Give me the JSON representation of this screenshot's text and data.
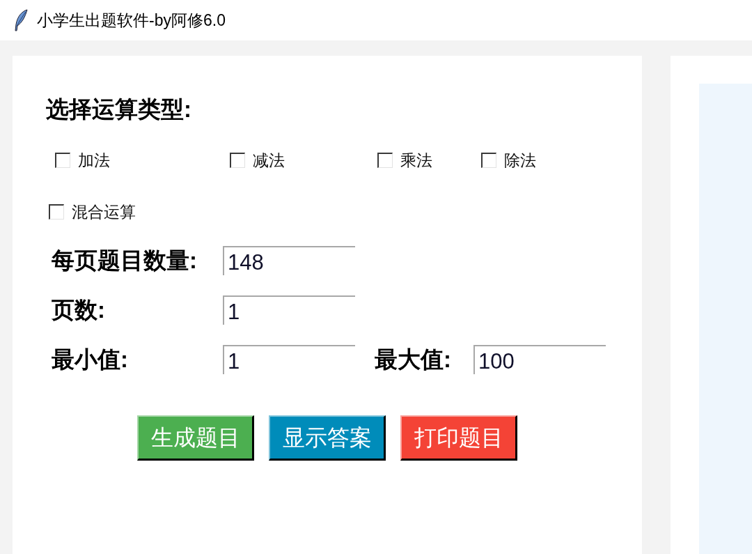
{
  "window": {
    "title": "小学生出题软件-by阿修6.0"
  },
  "operation_section": {
    "heading": "选择运算类型:",
    "options": [
      {
        "label": "加法",
        "checked": false
      },
      {
        "label": "减法",
        "checked": false
      },
      {
        "label": "乘法",
        "checked": false
      },
      {
        "label": "除法",
        "checked": false
      },
      {
        "label": "混合运算",
        "checked": false
      }
    ]
  },
  "fields": [
    [
      {
        "label": "每页题目数量:",
        "value": "148"
      }
    ],
    [
      {
        "label": "页数:",
        "value": "1"
      }
    ],
    [
      {
        "label": "最小值:",
        "value": "1"
      },
      {
        "label": "最大值:",
        "value": "100"
      }
    ]
  ],
  "buttons": [
    {
      "label": "生成题目",
      "color": "#4caf50"
    },
    {
      "label": "显示答案",
      "color": "#008cba"
    },
    {
      "label": "打印题目",
      "color": "#f44336"
    }
  ]
}
